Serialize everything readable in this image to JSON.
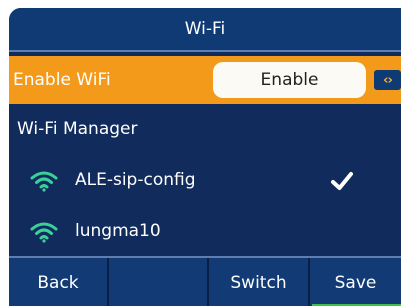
{
  "title": "Wi-Fi",
  "enable_row": {
    "label": "Enable WiFi",
    "value": "Enable",
    "arrows": "‹›"
  },
  "section": {
    "label": "Wi-Fi Manager"
  },
  "networks": [
    {
      "name": "ALE-sip-config",
      "connected": true,
      "icon": "wifi-icon"
    },
    {
      "name": "lungma10",
      "connected": false,
      "icon": "wifi-icon"
    }
  ],
  "softkeys": [
    "Back",
    "",
    "Switch",
    "Save"
  ],
  "colors": {
    "accent_orange": "#f39a1b",
    "background_navy": "#102b5c",
    "wifi_green": "#3bd09a",
    "save_indicator": "#3fbf4c"
  }
}
